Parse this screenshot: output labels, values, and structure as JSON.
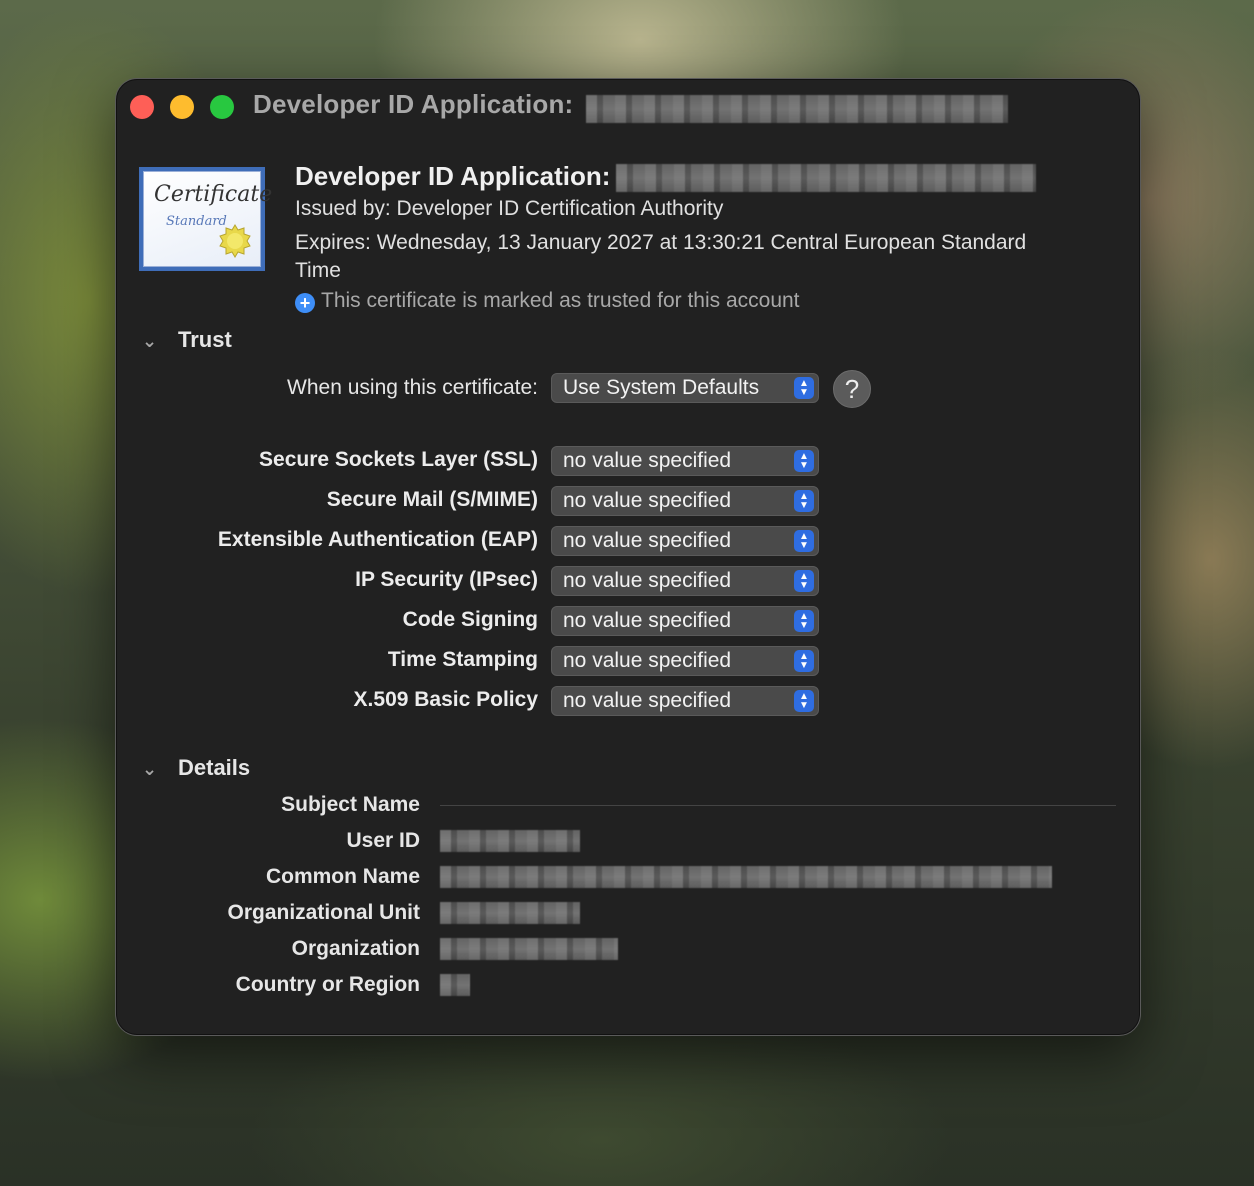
{
  "window": {
    "title": "Developer ID Application:"
  },
  "header": {
    "title": "Developer ID Application:",
    "issued_by": "Issued by: Developer ID Certification Authority",
    "expires": "Expires: Wednesday, 13 January 2027 at 13:30:21 Central European Standard Time",
    "trusted_note": "This certificate is marked as trusted for this account",
    "cert_icon_text_1": "Certificate",
    "cert_icon_text_2": "Standard"
  },
  "trust": {
    "heading": "Trust",
    "when_using_label": "When using this certificate:",
    "when_using_value": "Use System Defaults",
    "help_label": "?",
    "policies": [
      {
        "label": "Secure Sockets Layer (SSL)",
        "value": "no value specified"
      },
      {
        "label": "Secure Mail (S/MIME)",
        "value": "no value specified"
      },
      {
        "label": "Extensible Authentication (EAP)",
        "value": "no value specified"
      },
      {
        "label": "IP Security (IPsec)",
        "value": "no value specified"
      },
      {
        "label": "Code Signing",
        "value": "no value specified"
      },
      {
        "label": "Time Stamping",
        "value": "no value specified"
      },
      {
        "label": "X.509 Basic Policy",
        "value": "no value specified"
      }
    ]
  },
  "details": {
    "heading": "Details",
    "subject_name": "Subject Name",
    "fields": [
      {
        "label": "User ID"
      },
      {
        "label": "Common Name"
      },
      {
        "label": "Organizational Unit"
      },
      {
        "label": "Organization"
      },
      {
        "label": "Country or Region"
      }
    ]
  },
  "colors": {
    "window_bg": "#212121",
    "accent_blue": "#2f6de1",
    "traffic_red": "#fe5f57",
    "traffic_yellow": "#febc2e",
    "traffic_green": "#28c840"
  }
}
